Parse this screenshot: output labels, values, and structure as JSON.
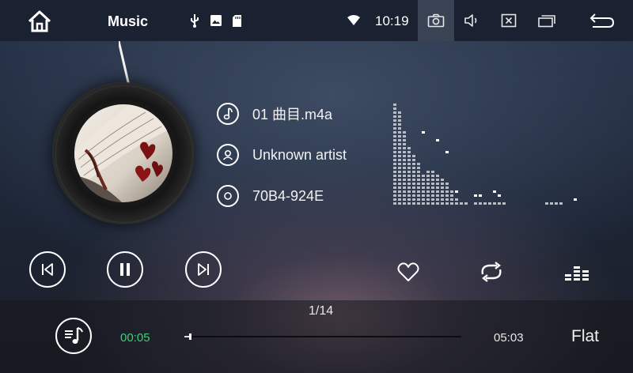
{
  "status_bar": {
    "title": "Music",
    "clock": "10:19",
    "icons": [
      "home-icon",
      "usb-icon",
      "image-icon",
      "sd-card-icon",
      "wifi-icon",
      "camera-icon",
      "volume-icon",
      "close-window-icon",
      "recent-apps-icon",
      "back-icon"
    ]
  },
  "track": {
    "title": "01 曲目.m4a",
    "artist": "Unknown artist",
    "album": "70B4-924E"
  },
  "playback": {
    "track_count": "1/14",
    "elapsed": "00:05",
    "total": "05:03",
    "progress": 0.0165,
    "eq_preset": "Flat"
  },
  "colors": {
    "elapsed_time": "#3fd07a",
    "statusbar_bg": "#1a2130",
    "camera_highlight": "#3a4354"
  },
  "spectrum_levels": [
    26,
    24,
    19,
    15,
    13,
    11,
    8,
    9,
    9,
    8,
    7,
    6,
    4,
    2,
    1,
    1,
    0,
    1,
    1,
    1,
    1,
    1,
    1,
    1,
    0,
    0,
    0,
    0,
    0,
    0,
    0,
    0,
    1,
    1,
    1,
    1,
    0,
    0,
    0,
    0
  ],
  "spectrum_peaks": [
    26,
    24,
    19,
    15,
    13,
    11,
    18,
    9,
    9,
    16,
    7,
    13,
    4,
    3,
    1,
    1,
    0,
    2,
    2,
    1,
    1,
    3,
    2,
    1,
    0,
    0,
    0,
    0,
    0,
    0,
    0,
    0,
    1,
    1,
    1,
    1,
    0,
    0,
    1,
    0
  ]
}
